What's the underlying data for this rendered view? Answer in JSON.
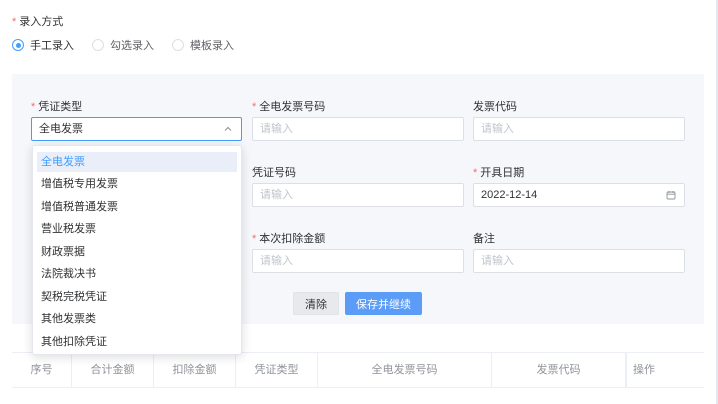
{
  "entry_mode": {
    "label": "录入方式",
    "options": [
      {
        "label": "手工录入",
        "checked": true
      },
      {
        "label": "勾选录入",
        "checked": false
      },
      {
        "label": "模板录入",
        "checked": false
      }
    ]
  },
  "form": {
    "voucher_type": {
      "label": "凭证类型",
      "value": "全电发票"
    },
    "einvoice_number": {
      "label": "全电发票号码",
      "placeholder": "请输入"
    },
    "invoice_code": {
      "label": "发票代码",
      "placeholder": "请输入"
    },
    "voucher_number": {
      "label": "凭证号码",
      "placeholder": "请输入"
    },
    "issue_date": {
      "label": "开具日期",
      "value": "2022-12-14"
    },
    "deduction_amount": {
      "label": "本次扣除金额",
      "placeholder": "请输入"
    },
    "remark": {
      "label": "备注",
      "placeholder": "请输入"
    }
  },
  "buttons": {
    "clear": "清除",
    "save_continue": "保存并继续"
  },
  "dropdown": {
    "items": [
      "全电发票",
      "增值税专用发票",
      "增值税普通发票",
      "营业税发票",
      "财政票据",
      "法院裁决书",
      "契税完税凭证",
      "其他发票类",
      "其他扣除凭证"
    ],
    "selected_index": 0
  },
  "table": {
    "columns": [
      "序号",
      "合计金额",
      "扣除金额",
      "凭证类型",
      "全电发票号码",
      "发票代码",
      "操作"
    ]
  },
  "colors": {
    "primary": "#409eff",
    "required": "#f56c6c",
    "panel_bg": "#f5f7fb"
  }
}
